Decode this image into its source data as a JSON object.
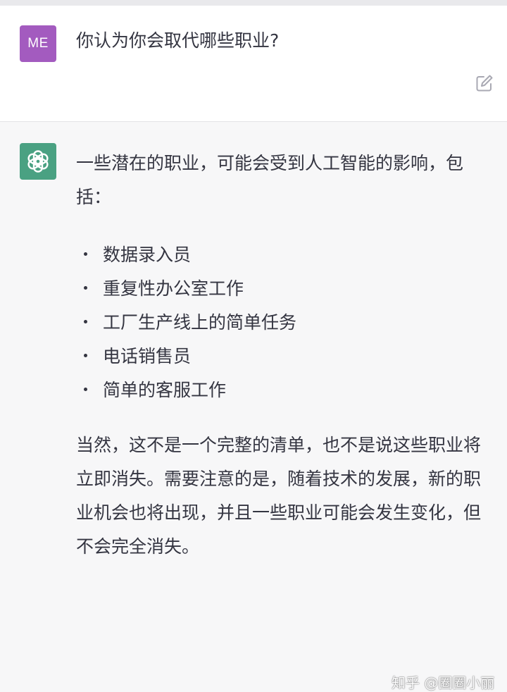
{
  "user_message": {
    "avatar_initials": "ME",
    "avatar_color": "#a35bbf",
    "text": "你认为你会取代哪些职业?",
    "edit_icon": "edit-icon"
  },
  "assistant_message": {
    "avatar_icon": "openai-logo-icon",
    "avatar_color": "#4aa182",
    "intro": "一些潜在的职业，可能会受到人工智能的影响，包括：",
    "items": [
      {
        "text": "数据录入员"
      },
      {
        "text": "重复性办公室工作"
      },
      {
        "text": "工厂生产线上的简单任务"
      },
      {
        "text": "电话销售员"
      },
      {
        "text": "简单的客服工作"
      }
    ],
    "outro": "当然，这不是一个完整的清单，也不是说这些职业将立即消失。需要注意的是，随着技术的发展，新的职业机会也将出现，并且一些职业可能会发生变化，但不会完全消失。"
  },
  "watermark": "知乎 @圈圈小丽"
}
